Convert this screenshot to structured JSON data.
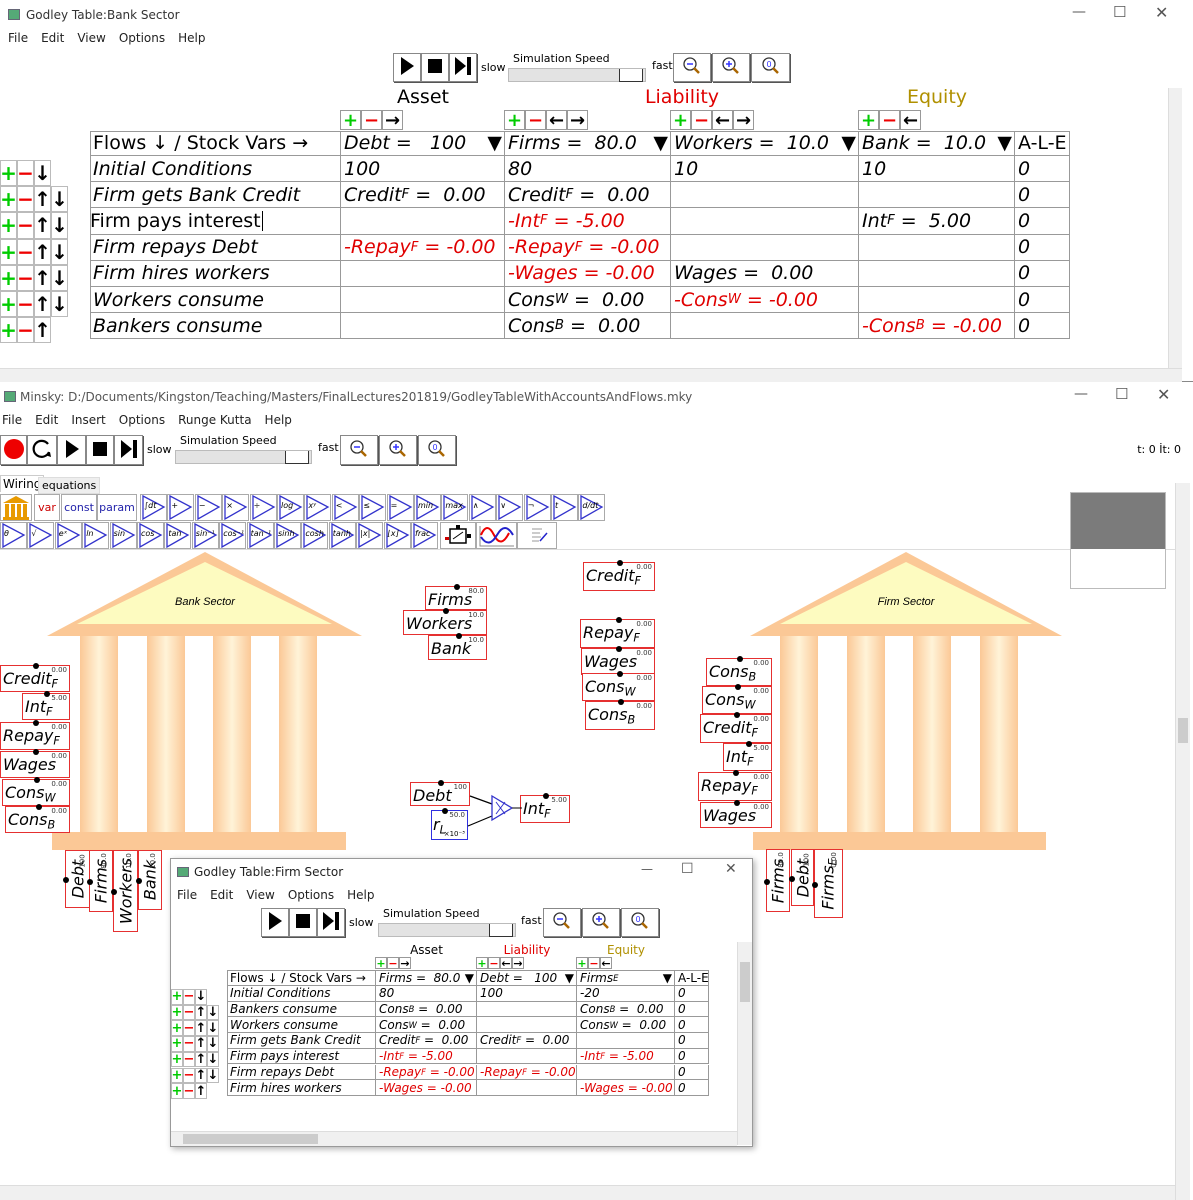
{
  "bank_window": {
    "title": "Godley Table:Bank Sector",
    "menu": [
      "File",
      "Edit",
      "View",
      "Options",
      "Help"
    ],
    "slow": "slow",
    "fast": "fast",
    "speed_label": "Simulation Speed",
    "groups": [
      {
        "label": "Asset",
        "color": "#000000"
      },
      {
        "label": "Liability",
        "color": "#e00000"
      },
      {
        "label": "Equity",
        "color": "#b09000"
      }
    ],
    "header": {
      "flows": "Flows ↓ / Stock Vars →",
      "ale": "A-L-E",
      "cols": [
        {
          "n": "Debt",
          "s": "",
          "r": " =   100"
        },
        {
          "n": "Firms",
          "s": "",
          "r": " =  80.0"
        },
        {
          "n": "Workers",
          "s": "",
          "r": " =  10.0"
        },
        {
          "n": "Bank",
          "s": "",
          "r": " =  10.0"
        }
      ]
    },
    "rows": [
      {
        "label": "Initial Conditions",
        "cells": [
          {
            "n": "100"
          },
          {
            "n": "80"
          },
          {
            "n": "10"
          },
          {
            "n": "10"
          }
        ],
        "ale": "0"
      },
      {
        "label": "Firm gets Bank Credit",
        "cells": [
          {
            "n": "Credit",
            "s": "F",
            "r": " =  0.00"
          },
          {
            "n": "Credit",
            "s": "F",
            "r": " =  0.00"
          },
          null,
          null
        ],
        "ale": "0"
      },
      {
        "label": "Firm pays interest",
        "editing": true,
        "cells": [
          null,
          {
            "n": "-Int",
            "s": "F",
            "r": " = -5.00",
            "red": true
          },
          null,
          {
            "n": "Int",
            "s": "F",
            "r": " =  5.00"
          }
        ],
        "ale": "0"
      },
      {
        "label": "Firm repays Debt",
        "cells": [
          {
            "n": "-Repay",
            "s": "F",
            "r": " = -0.00",
            "red": true
          },
          {
            "n": "-Repay",
            "s": "F",
            "r": " = -0.00",
            "red": true
          },
          null,
          null
        ],
        "ale": "0"
      },
      {
        "label": "Firm hires workers",
        "cells": [
          null,
          {
            "n": "-Wages",
            "s": "",
            "r": " = -0.00",
            "red": true
          },
          {
            "n": "Wages",
            "s": "",
            "r": " =  0.00"
          },
          null
        ],
        "ale": "0"
      },
      {
        "label": "Workers consume",
        "cells": [
          null,
          {
            "n": "Cons",
            "s": "W",
            "r": " =  0.00"
          },
          {
            "n": "-Cons",
            "s": "W",
            "r": " = -0.00",
            "red": true
          },
          null
        ],
        "ale": "0"
      },
      {
        "label": "Bankers consume",
        "cells": [
          null,
          {
            "n": "Cons",
            "s": "B",
            "r": " =  0.00"
          },
          null,
          {
            "n": "-Cons",
            "s": "B",
            "r": " = -0.00",
            "red": true
          }
        ],
        "ale": "0"
      }
    ]
  },
  "minsky": {
    "title": "Minsky: D:/Documents/Kingston/Teaching/Masters/FinalLectures201819/GodleyTableWithAccountsAndFlows.mky",
    "menu": [
      "File",
      "Edit",
      "Insert",
      "Options",
      "Runge Kutta",
      "Help"
    ],
    "slow": "slow",
    "fast": "fast",
    "speed_label": "Simulation Speed",
    "time": "t: 0 İt: 0",
    "tabs": [
      "Wiring",
      "equations"
    ],
    "palette_row1": {
      "var": "var",
      "const": "const",
      "param": "param",
      "ops": [
        "∫dt",
        "+",
        "−",
        "×",
        "÷",
        "log",
        "xʸ",
        "<",
        "≤",
        "=",
        "min",
        "max",
        "∧",
        "∨",
        "¬",
        "t",
        "d/dt"
      ]
    },
    "palette_row2": [
      "θ",
      "√",
      "eˣ",
      "ln",
      "sin",
      "cos",
      "tan",
      "sin⁻¹",
      "cos⁻¹",
      "tan⁻¹",
      "sinh",
      "cosh",
      "tanh",
      "|x|",
      "⌊x⌋",
      "frac"
    ],
    "colors": {
      "record": "#ee0000",
      "var_border": "#e53030",
      "param_border": "#3030e0",
      "temple": "#fbc896",
      "pediment": "#fdfbc0"
    },
    "canvas": {
      "temples": [
        "Bank Sector",
        "Firm Sector"
      ],
      "vars": [
        {
          "n": "Credit",
          "s": "F",
          "v": "0.00"
        },
        {
          "n": "Int",
          "s": "F",
          "v": "5.00"
        },
        {
          "n": "Repay",
          "s": "F",
          "v": "0.00"
        },
        {
          "n": "Wages",
          "s": "",
          "v": "0.00"
        },
        {
          "n": "Cons",
          "s": "W",
          "v": "0.00"
        },
        {
          "n": "Cons",
          "s": "B",
          "v": "0.00"
        },
        {
          "n": "Debt",
          "s": "",
          "v": "100"
        },
        {
          "n": "Firms",
          "s": "",
          "v": "80.0"
        },
        {
          "n": "Workers",
          "s": "",
          "v": "10.0"
        },
        {
          "n": "Bank",
          "s": "",
          "v": "10.0"
        },
        {
          "n": "Firms",
          "s": "",
          "v": "80.0"
        },
        {
          "n": "Workers",
          "s": "",
          "v": "10.0"
        },
        {
          "n": "Bank",
          "s": "",
          "v": "10.0"
        },
        {
          "n": "Credit",
          "s": "F",
          "v": "0.00"
        },
        {
          "n": "Repay",
          "s": "F",
          "v": "0.00"
        },
        {
          "n": "Wages",
          "s": "",
          "v": "0.00"
        },
        {
          "n": "Cons",
          "s": "W",
          "v": "0.00"
        },
        {
          "n": "Cons",
          "s": "B",
          "v": "0.00"
        },
        {
          "n": "Cons",
          "s": "B",
          "v": "0.00"
        },
        {
          "n": "Cons",
          "s": "W",
          "v": "0.00"
        },
        {
          "n": "Credit",
          "s": "F",
          "v": "0.00"
        },
        {
          "n": "Int",
          "s": "F",
          "v": "5.00"
        },
        {
          "n": "Repay",
          "s": "F",
          "v": "0.00"
        },
        {
          "n": "Wages",
          "s": "",
          "v": "0.00"
        },
        {
          "n": "Firms",
          "s": "",
          "v": "80.0"
        },
        {
          "n": "Debt",
          "s": "",
          "v": "100"
        },
        {
          "n": "Firms",
          "s": "E",
          "v": "0.00"
        },
        {
          "n": "Debt",
          "s": "",
          "v": "100"
        },
        {
          "n": "Int",
          "s": "F",
          "v": "5.00"
        }
      ],
      "param": {
        "n": "r",
        "s": "L",
        "v": "50.0",
        "scale": "×10⁻³"
      }
    }
  },
  "firm_window": {
    "title": "Godley Table:Firm Sector",
    "menu": [
      "File",
      "Edit",
      "View",
      "Options",
      "Help"
    ],
    "slow": "slow",
    "fast": "fast",
    "speed_label": "Simulation Speed",
    "groups": [
      {
        "label": "Asset",
        "color": "#000000"
      },
      {
        "label": "Liability",
        "color": "#e00000"
      },
      {
        "label": "Equity",
        "color": "#b09000"
      }
    ],
    "header": {
      "flows": "Flows ↓ / Stock Vars →",
      "ale": "A-L-E",
      "cols": [
        {
          "n": "Firms",
          "s": "",
          "r": " =  80.0"
        },
        {
          "n": "Debt",
          "s": "",
          "r": " =   100"
        },
        {
          "n": "Firms",
          "s": "E",
          "r": ""
        }
      ]
    },
    "rows": [
      {
        "label": "Initial Conditions",
        "cells": [
          {
            "n": "80"
          },
          {
            "n": "100"
          },
          {
            "n": "-20"
          }
        ],
        "ale": "0"
      },
      {
        "label": "Bankers consume",
        "cells": [
          {
            "n": "Cons",
            "s": "B",
            "r": " =  0.00"
          },
          null,
          {
            "n": "Cons",
            "s": "B",
            "r": " =  0.00"
          }
        ],
        "ale": "0"
      },
      {
        "label": "Workers consume",
        "cells": [
          {
            "n": "Cons",
            "s": "W",
            "r": " =  0.00"
          },
          null,
          {
            "n": "Cons",
            "s": "W",
            "r": " =  0.00"
          }
        ],
        "ale": "0"
      },
      {
        "label": "Firm gets Bank Credit",
        "cells": [
          {
            "n": "Credit",
            "s": "F",
            "r": " =  0.00"
          },
          {
            "n": "Credit",
            "s": "F",
            "r": " =  0.00"
          },
          null
        ],
        "ale": "0"
      },
      {
        "label": "Firm pays interest",
        "cells": [
          {
            "n": "-Int",
            "s": "F",
            "r": " = -5.00",
            "red": true
          },
          null,
          {
            "n": "-Int",
            "s": "F",
            "r": " = -5.00",
            "red": true
          }
        ],
        "ale": "0"
      },
      {
        "label": "Firm repays Debt",
        "cells": [
          {
            "n": "-Repay",
            "s": "F",
            "r": " = -0.00",
            "red": true
          },
          {
            "n": "-Repay",
            "s": "F",
            "r": " = -0.00",
            "red": true
          },
          null
        ],
        "ale": "0"
      },
      {
        "label": "Firm hires workers",
        "cells": [
          {
            "n": "-Wages",
            "s": "",
            "r": " = -0.00",
            "red": true
          },
          null,
          {
            "n": "-Wages",
            "s": "",
            "r": " = -0.00",
            "red": true
          }
        ],
        "ale": "0"
      }
    ]
  }
}
